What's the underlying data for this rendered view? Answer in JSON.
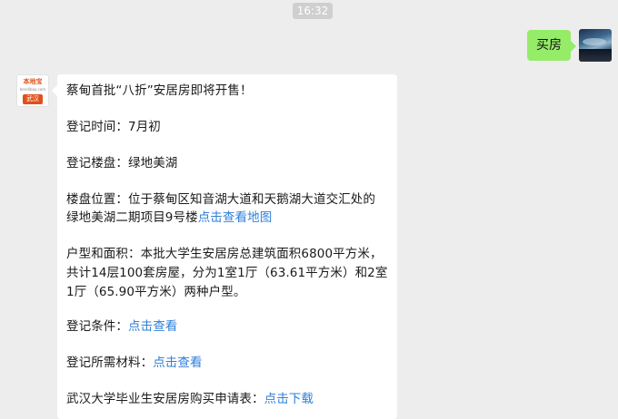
{
  "header": {
    "time": "16:32"
  },
  "messages": {
    "outgoing": {
      "text": "买房"
    },
    "incoming": {
      "sender_logo": {
        "brand": "本地宝",
        "url": "bendibao.com",
        "city": "武汉"
      },
      "title": "蔡甸首批“八折”安居房即将开售！",
      "register_time": "登记时间：7月初",
      "register_property": "登记楼盘：绿地美湖",
      "location_line1": "楼盘位置：位于蔡甸区知音湖大道和天鹅湖大道交汇处的",
      "location_line2_text": "绿地美湖二期项目9号楼",
      "location_link": "点击查看地图",
      "area_line1": "户型和面积：本批大学生安居房总建筑面积6800平方米，",
      "area_line2": "共计14层100套房屋，分为1室1厅（63.61平方米）和2室",
      "area_line3": "1厅（65.90平方米）两种户型。",
      "conditions_label": "登记条件：",
      "conditions_link": "点击查看",
      "materials_label": "登记所需材料：",
      "materials_link": "点击查看",
      "form_label": "武汉大学毕业生安居房购买申请表：",
      "form_link": "点击下载"
    }
  }
}
